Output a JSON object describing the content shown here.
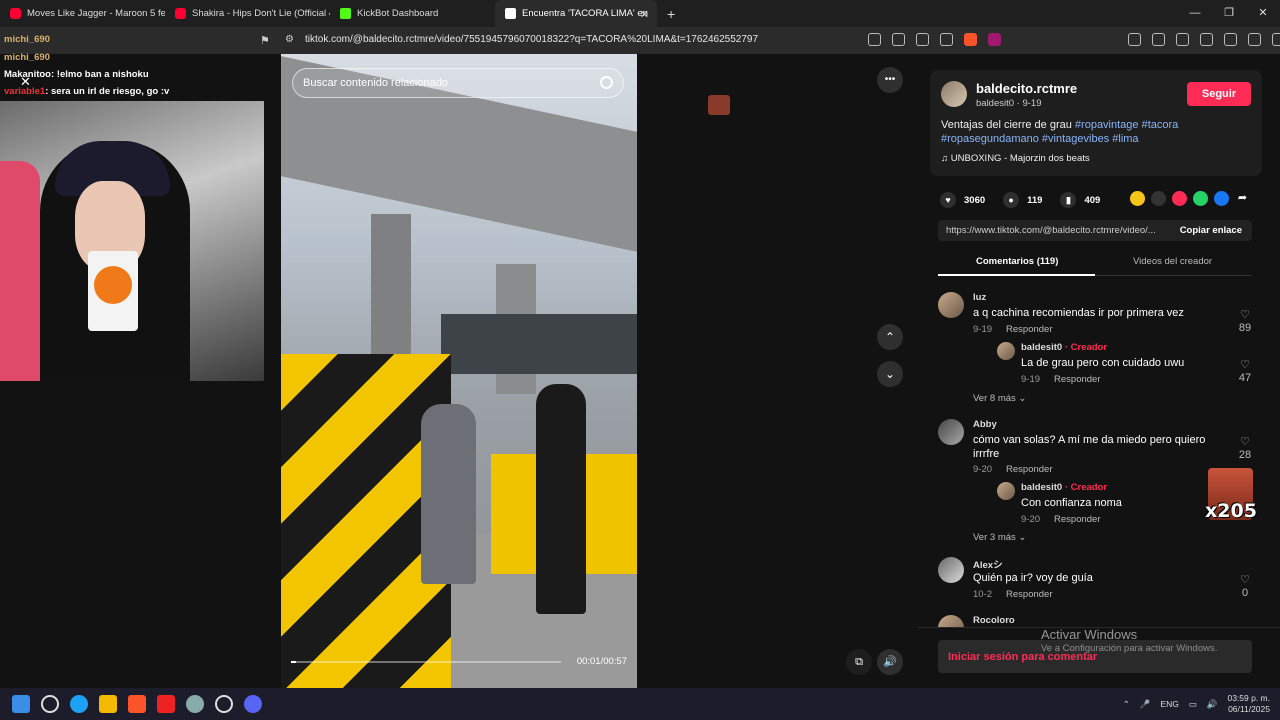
{
  "browser": {
    "tabs": [
      {
        "label": "Moves Like Jagger - Maroon 5 featu",
        "icon": "youtube-icon",
        "active": false
      },
      {
        "label": "Shakira - Hips Don't Lie (Official 4K V",
        "icon": "youtube-icon",
        "active": false
      },
      {
        "label": "KickBot Dashboard",
        "icon": "kick-icon",
        "active": false
      },
      {
        "label": "Encuentra 'TACORA LIMA' en",
        "icon": "tiktok-icon",
        "active": true
      }
    ],
    "new_tab": "+",
    "url": "tiktok.com/@baldecito.rctmre/video/7551945796070018322?q=TACORA%20LIMA&t=1762462552797"
  },
  "chat": {
    "lines": [
      {
        "user": "michi_690",
        "text": ""
      },
      {
        "user": "michi_690",
        "text": ""
      },
      {
        "user": "Makanitoo",
        "text": ": !elmo ban a nishoku"
      },
      {
        "user": "variable1",
        "text": ": sera un irl de riesgo, go :v"
      }
    ]
  },
  "video": {
    "search_placeholder": "Buscar contenido relacionado",
    "time": "00:01/00:57",
    "progress": 0.02,
    "more": "•••",
    "up": "⌃",
    "down": "⌄"
  },
  "author": {
    "username": "baldecito.rctmre",
    "subtitle": "baldesit0 · 9-19",
    "follow_label": "Seguir",
    "description_text": "Ventajas del cierre de grau ",
    "tags": [
      "#ropavintage",
      "#tacora",
      "#ropasegundamano",
      "#vintagevibes",
      "#lima"
    ],
    "music": "UNBOXING - Majorzin dos beats"
  },
  "stats": {
    "likes": "3060",
    "comments": "119",
    "saves": "409"
  },
  "link": {
    "url": "https://www.tiktok.com/@baldecito.rctmre/video/...",
    "copy_label": "Copiar enlace"
  },
  "tabs": {
    "comments": "Comentarios (119)",
    "creator_videos": "Videos del creador"
  },
  "comments": [
    {
      "user": "luz",
      "text": "a q cachina recomiendas ir por primera vez",
      "date": "9-19",
      "reply": "Responder",
      "likes": "89",
      "creator_reply": {
        "user": "baldesit0",
        "badge": "· Creador",
        "text": "La de grau pero con cuidado uwu",
        "date": "9-19",
        "reply": "Responder",
        "likes": "47"
      },
      "more": "Ver 8 más"
    },
    {
      "user": "Abby",
      "text": "cómo van solas? A mí me da miedo pero quiero irrrfre",
      "date": "9-20",
      "reply": "Responder",
      "likes": "28",
      "creator_reply": {
        "user": "baldesit0",
        "badge": "· Creador",
        "text": "Con confianza noma",
        "date": "9-20",
        "reply": "Responder"
      },
      "more": "Ver 3 más"
    },
    {
      "user": "Alexシ",
      "text": "Quién pa ir? voy de guía",
      "date": "10-2",
      "reply": "Responder",
      "likes": "0"
    },
    {
      "user": "Rocoloro"
    }
  ],
  "login_label": "Iniciar sesión para comentar",
  "windows": {
    "activate_title": "Activar Windows",
    "activate_sub": "Ve a Configuración para activar Windows.",
    "overlay_text": "x205",
    "lang": "ENG",
    "time": "03:59 p. m.",
    "date": "06/11/2025"
  },
  "colors": {
    "accent": "#fe2c55",
    "tag": "#8ab4f8"
  }
}
